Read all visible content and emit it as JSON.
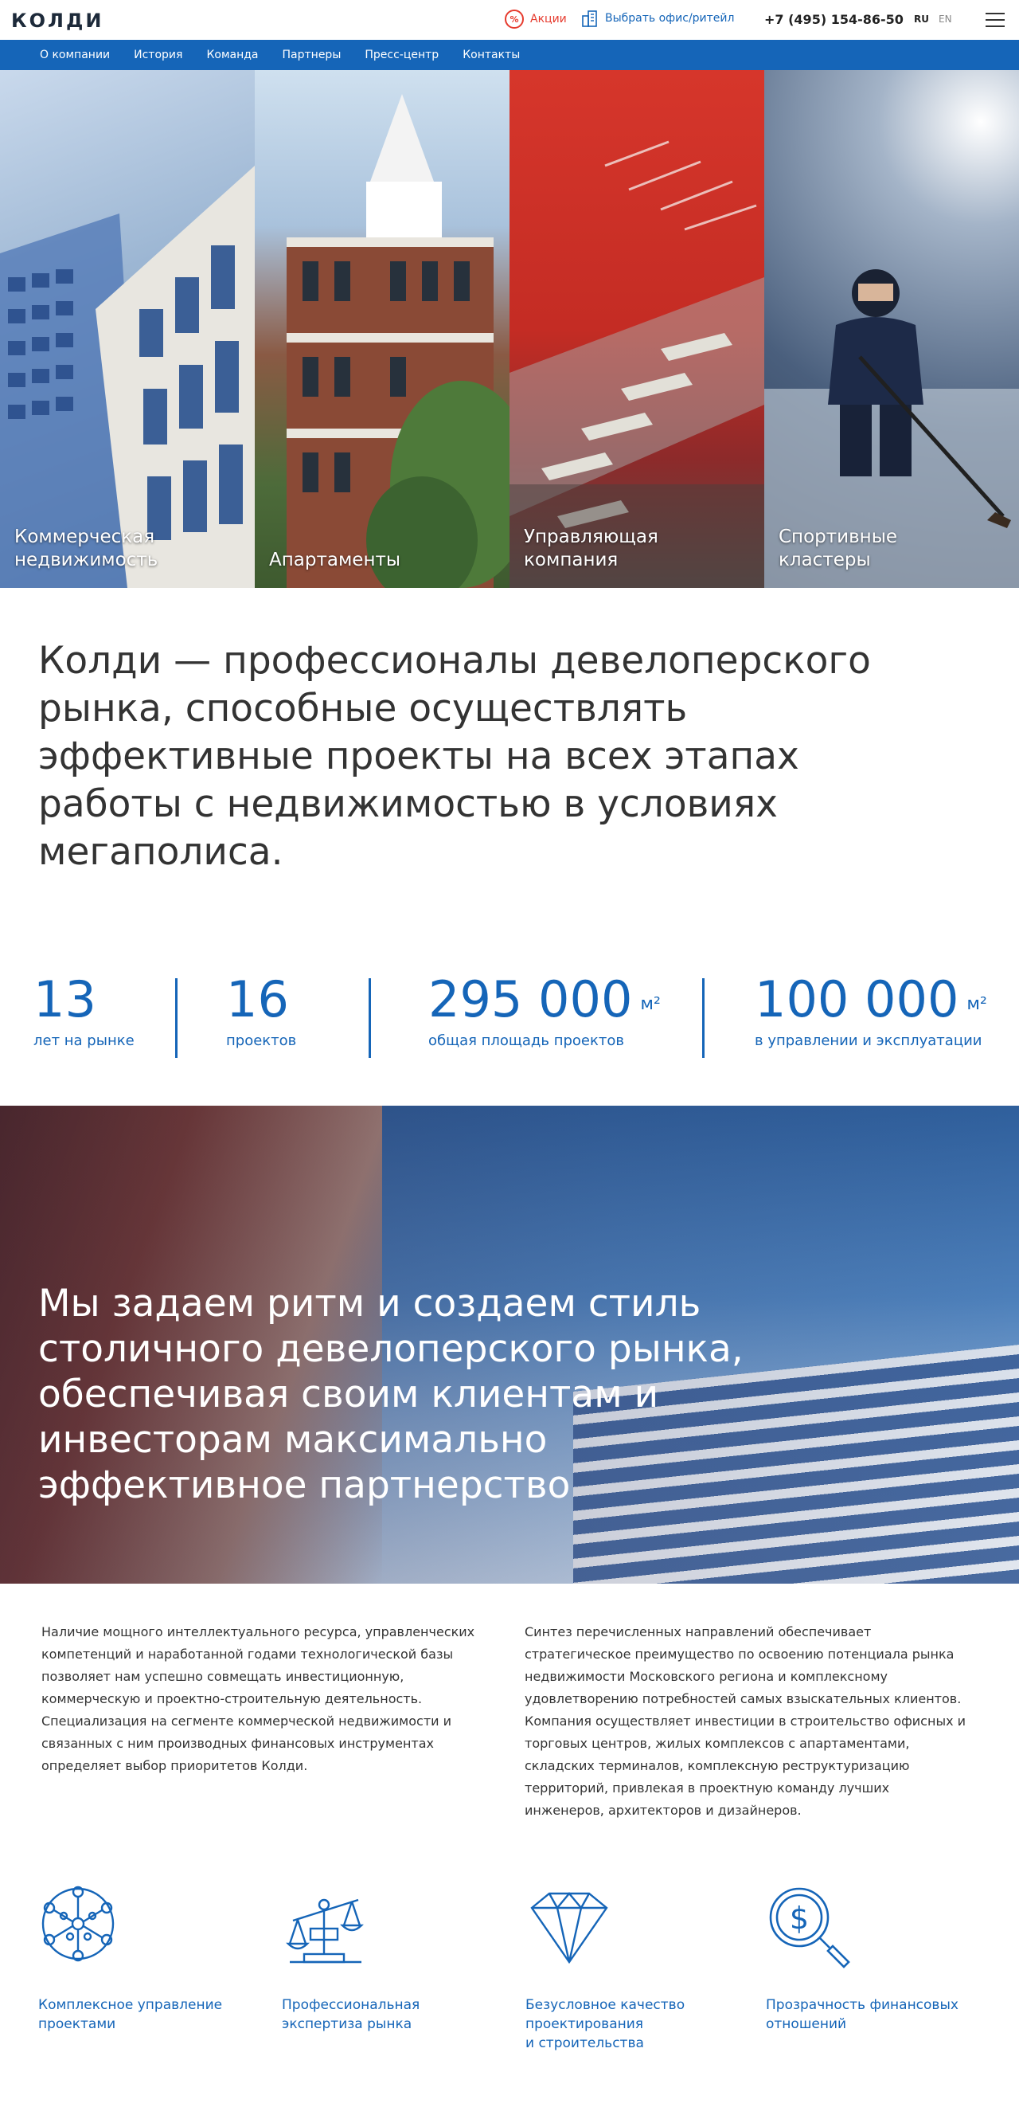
{
  "header": {
    "logo_text": "КОЛДИ",
    "promo_label": "Акции",
    "promo_icon": "percent-icon",
    "choose_label": "Выбрать офис/ритейл",
    "choose_icon": "building-icon",
    "phone": "+7 (495) 154-86-50",
    "lang_ru": "RU",
    "lang_en": "EN",
    "menu_icon": "hamburger-icon",
    "accent_color": "#1565b8",
    "promo_color": "#e63b2e"
  },
  "nav": {
    "items": [
      "О компании",
      "История",
      "Команда",
      "Партнеры",
      "Пресс-центр",
      "Контакты"
    ]
  },
  "tiles": [
    {
      "label": "Коммерческая\nнедвижимость"
    },
    {
      "label": "Апартаменты"
    },
    {
      "label": "Управляющая\nкомпания"
    },
    {
      "label": "Спортивные\nкластеры"
    }
  ],
  "intro": "Колди — профессионалы девелоперского рынка, способные осуществлять эффективные проекты на всех этапах работы с недвижимостью в условиях мегаполиса.",
  "stats": [
    {
      "value": "13",
      "unit": "",
      "label": "лет на рынке"
    },
    {
      "value": "16",
      "unit": "",
      "label": "проектов"
    },
    {
      "value": "295 000",
      "unit": "м²",
      "label": "общая площадь проектов"
    },
    {
      "value": "100 000",
      "unit": "м²",
      "label": "в управлении и эксплуатации"
    }
  ],
  "banner_text": "Мы задаем ритм и создаем стиль столичного девелоперского рынка, обеспечивая своим клиентам и инвесторам максимально эффективное партнерство",
  "columns": {
    "left": "Наличие мощного интеллектуального ресурса, управленческих компетенций и наработанной годами технологической базы позволяет нам успешно совмещать инвестиционную, коммерческую и проектно-строительную деятельность. Специализация на сегменте коммерческой недвижимости и связанных с ним производных финансовых инструментах определяет выбор приоритетов Колди.",
    "right": "Синтез перечисленных направлений обеспечивает стратегическое преимущество по освоению потенциала рынка недвижимости Московского региона и комплексному удовлетворению потребностей самых взыскательных клиентов. Компания осуществляет инвестиции в строительство офисных и торговых центров, жилых комплексов с апартаментами, складских терминалов, комплексную реструктуризацию территорий, привлекая в проектную команду лучших инженеров, архитекторов и дизайнеров."
  },
  "features": [
    {
      "icon": "network-icon",
      "label": "Комплексное управление\nпроектами"
    },
    {
      "icon": "scales-icon",
      "label": "Профессиональная\nэкспертиза рынка"
    },
    {
      "icon": "diamond-icon",
      "label": "Безусловное качество\nпроектирования\nи строительства"
    },
    {
      "icon": "dollar-magnifier-icon",
      "label": "Прозрачность финансовых\nотношений"
    }
  ]
}
